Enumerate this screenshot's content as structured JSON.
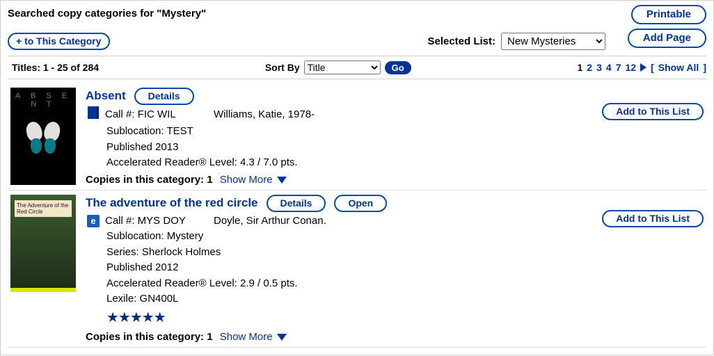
{
  "header": {
    "title": "Searched copy categories for \"Mystery\"",
    "printable_label": "Printable",
    "addpage_label": "Add Page",
    "addcategory_label": "+ to This Category",
    "selected_list_label": "Selected List:",
    "selected_list_value": "New Mysteries"
  },
  "toolbar": {
    "count_text": "Titles: 1 - 25 of 284",
    "sort_label": "Sort By",
    "sort_value": "Title",
    "go_label": "Go",
    "pages": [
      "1",
      "2",
      "3",
      "4",
      "7",
      "12"
    ],
    "showall_label": "Show All"
  },
  "common": {
    "details_label": "Details",
    "open_label": "Open",
    "addlist_label": "Add to This List",
    "copies_prefix": "Copies in this category:",
    "showmore_label": "Show More"
  },
  "records": [
    {
      "title": "Absent",
      "type": "book",
      "call": "Call #: FIC WIL",
      "author": "Williams, Katie, 1978-",
      "lines": [
        "Sublocation: TEST",
        "Published 2013",
        "Accelerated Reader® Level: 4.3 / 7.0 pts."
      ],
      "copies": "1",
      "has_open": false,
      "stars": 0
    },
    {
      "title": "The adventure of the red circle",
      "type": "ebook",
      "call": "Call #: MYS DOY",
      "author": "Doyle, Sir Arthur Conan.",
      "lines": [
        "Sublocation: Mystery",
        "Series: Sherlock Holmes",
        "Published 2012",
        "Accelerated Reader® Level: 2.9 / 0.5 pts.",
        "Lexile: GN400L"
      ],
      "copies": "1",
      "has_open": true,
      "stars": 5
    }
  ]
}
